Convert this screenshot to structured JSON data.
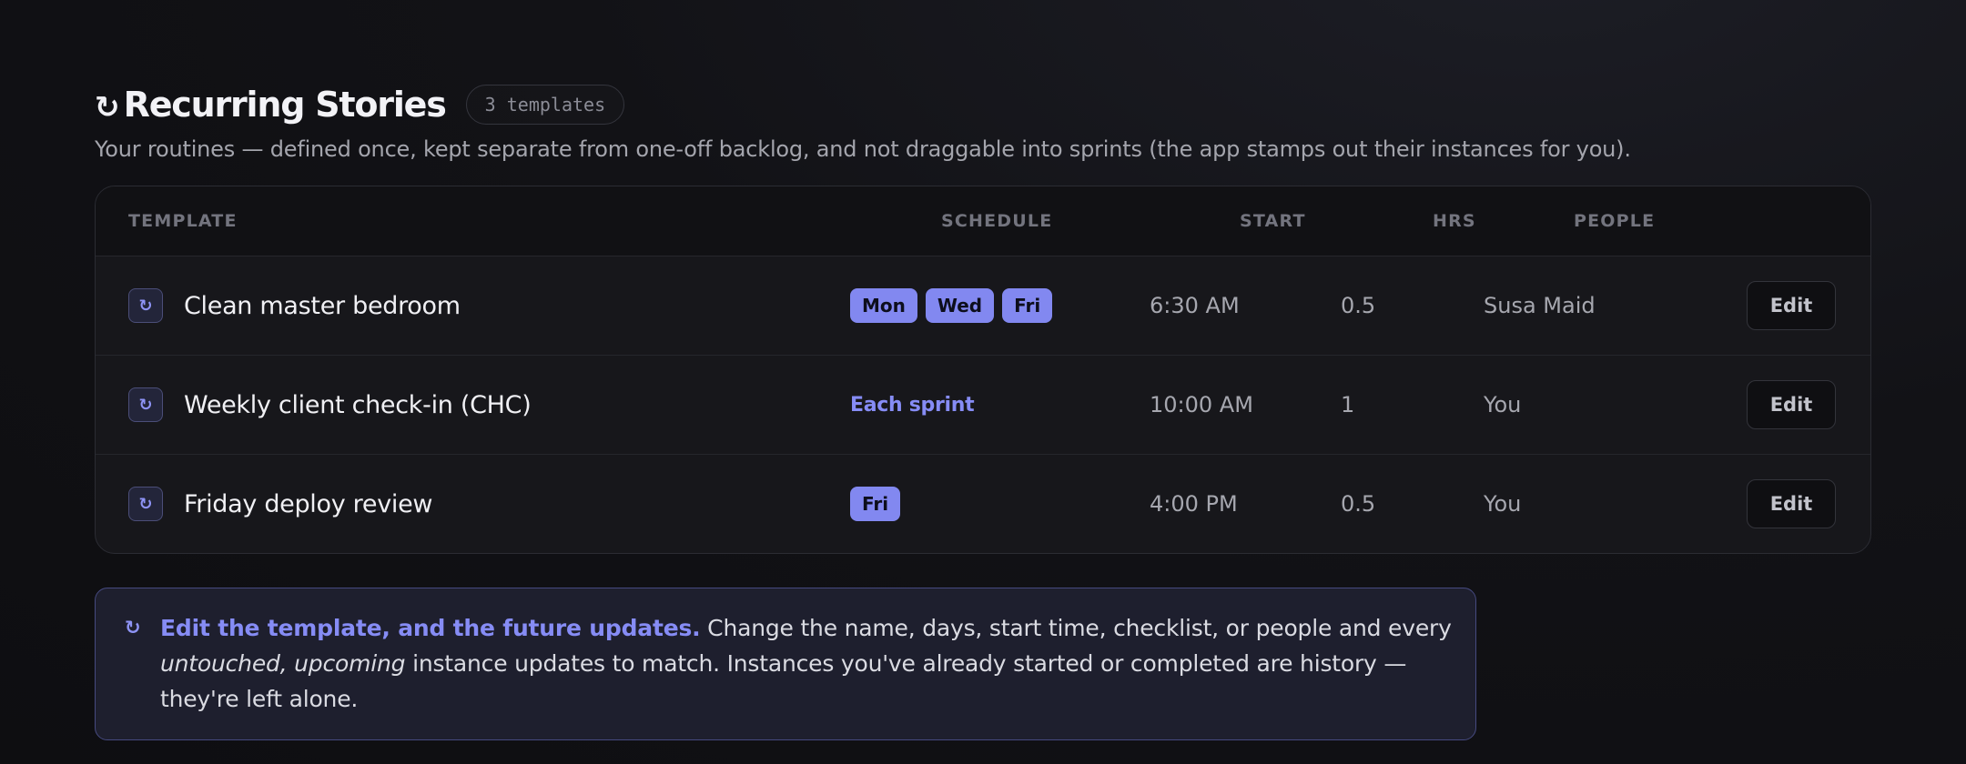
{
  "header": {
    "icon": "↻",
    "icon_name": "recurring-icon",
    "title": "Recurring Stories",
    "badge": "3 templates",
    "subtitle": "Your routines — defined once, kept separate from one-off backlog, and not draggable into sprints (the app stamps out their instances for you)."
  },
  "table": {
    "columns": {
      "template": "TEMPLATE",
      "schedule": "SCHEDULE",
      "start": "START",
      "hrs": "HRS",
      "people": "PEOPLE"
    },
    "rows": [
      {
        "icon": "↻",
        "name": "Clean master bedroom",
        "schedule_days": [
          "Mon",
          "Wed",
          "Fri"
        ],
        "schedule_text": "",
        "start": "6:30 AM",
        "hrs": "0.5",
        "people": "Susa Maid",
        "action": "Edit"
      },
      {
        "icon": "↻",
        "name": "Weekly client check-in (CHC)",
        "schedule_days": [],
        "schedule_text": "Each sprint",
        "start": "10:00 AM",
        "hrs": "1",
        "people": "You",
        "action": "Edit"
      },
      {
        "icon": "↻",
        "name": "Friday deploy review",
        "schedule_days": [
          "Fri"
        ],
        "schedule_text": "",
        "start": "4:00 PM",
        "hrs": "0.5",
        "people": "You",
        "action": "Edit"
      }
    ]
  },
  "note": {
    "icon": "↻",
    "strong": "Edit the template, and the future updates.",
    "text_1": " Change the name, days, start time, checklist, or people and every ",
    "emphasis": "untouched, upcoming",
    "text_2": " instance updates to match. Instances you've already started or completed are history — they're left alone."
  },
  "colors": {
    "accent": "#8288f0",
    "accent_text": "#868cf5",
    "background": "#121216",
    "card": "#17171b",
    "note_bg": "#1e1f2e"
  }
}
